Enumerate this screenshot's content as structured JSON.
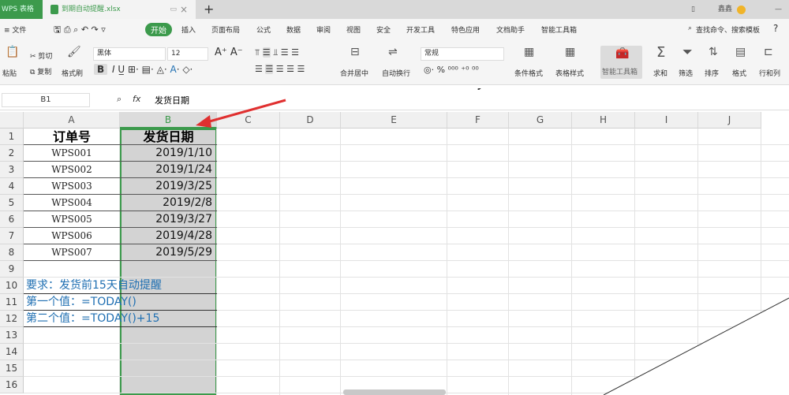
{
  "titlebar": {
    "app": "WPS 表格",
    "doc": "到期自动提醒.xlsx",
    "close": "×",
    "new_tab": "+",
    "user": "鑫鑫",
    "minimize": "—"
  },
  "menu": {
    "file": "≡ 文件",
    "tabs": [
      "开始",
      "插入",
      "页面布局",
      "公式",
      "数据",
      "审阅",
      "视图",
      "安全",
      "开发工具",
      "特色应用",
      "文档助手",
      "智能工具箱"
    ],
    "search": "查找命令、搜索模板",
    "help": "?"
  },
  "ribbon": {
    "paste": "粘贴",
    "cut": "剪切",
    "copy": "复制",
    "format_painter": "格式刷",
    "font": "黑体",
    "size": "12",
    "merge": "合并居中",
    "wrap": "自动换行",
    "number_format": "常规",
    "cond_format": "条件格式",
    "table_style": "表格样式",
    "smart_tools": "智能工具箱",
    "sum": "求和",
    "filter": "筛选",
    "sort": "排序",
    "format": "格式",
    "rowcol": "行和列"
  },
  "formula": {
    "namebox": "B1",
    "fx": "fx",
    "value": "发货日期"
  },
  "columns": [
    "A",
    "B",
    "C",
    "D",
    "E",
    "F",
    "G",
    "H",
    "I",
    "J"
  ],
  "rows": [
    "1",
    "2",
    "3",
    "4",
    "5",
    "6",
    "7",
    "8",
    "9",
    "10",
    "11",
    "12",
    "13",
    "14",
    "15",
    "16"
  ],
  "table": {
    "headers": [
      "订单号",
      "发货日期"
    ],
    "ids": [
      "WPS001",
      "WPS002",
      "WPS003",
      "WPS004",
      "WPS005",
      "WPS006",
      "WPS007"
    ],
    "dates": [
      "2019/1/10",
      "2019/1/24",
      "2019/3/25",
      "2019/2/8",
      "2019/3/27",
      "2019/4/28",
      "2019/5/29"
    ]
  },
  "notes": [
    "要求：发货前15天自动提醒",
    "第一个值：=TODAY()",
    "第二个值：=TODAY()+15"
  ],
  "colors": {
    "accent": "#3c9a4c",
    "note": "#1f6fb2",
    "arrow": "#e03030"
  }
}
